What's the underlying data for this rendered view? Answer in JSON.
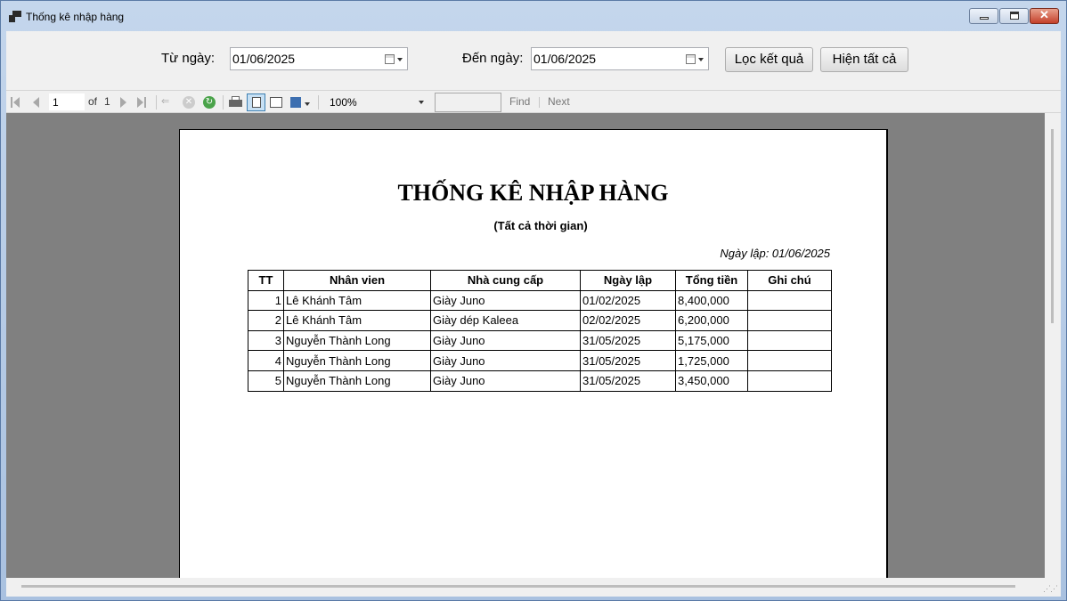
{
  "window": {
    "title": "Thống kê nhập hàng"
  },
  "filter": {
    "from_label": "Từ ngày:",
    "from_value": "01/06/2025",
    "to_label": "Đến ngày:",
    "to_value": "01/06/2025",
    "filter_button": "Lọc kết quả",
    "show_all_button": "Hiện tất cả"
  },
  "toolbar": {
    "current_page": "1",
    "of_label": "of",
    "total_pages": "1",
    "zoom": "100%",
    "find_label": "Find",
    "next_label": "Next"
  },
  "report": {
    "title": "THỐNG KÊ NHẬP HÀNG",
    "subtitle": "(Tất cả thời gian)",
    "created_date": "Ngày lập: 01/06/2025",
    "columns": [
      "TT",
      "Nhân vien",
      "Nhà cung cấp",
      "Ngày lập",
      "Tổng tiền",
      "Ghi chú"
    ],
    "rows": [
      {
        "tt": "1",
        "employee": "Lê Khánh Tâm",
        "supplier": "Giày Juno",
        "date": "01/02/2025",
        "total": "8,400,000",
        "note": ""
      },
      {
        "tt": "2",
        "employee": "Lê Khánh Tâm",
        "supplier": "Giày dép Kaleea",
        "date": "02/02/2025",
        "total": "6,200,000",
        "note": ""
      },
      {
        "tt": "3",
        "employee": "Nguyễn Thành Long",
        "supplier": "Giày Juno",
        "date": "31/05/2025",
        "total": "5,175,000",
        "note": ""
      },
      {
        "tt": "4",
        "employee": "Nguyễn Thành Long",
        "supplier": "Giày Juno",
        "date": "31/05/2025",
        "total": "1,725,000",
        "note": ""
      },
      {
        "tt": "5",
        "employee": "Nguyễn Thành Long",
        "supplier": "Giày Juno",
        "date": "31/05/2025",
        "total": "3,450,000",
        "note": ""
      }
    ]
  },
  "colors": {
    "viewer_bg": "#808080",
    "window_frame": "#a9c1e0",
    "close_button": "#c4402a"
  }
}
